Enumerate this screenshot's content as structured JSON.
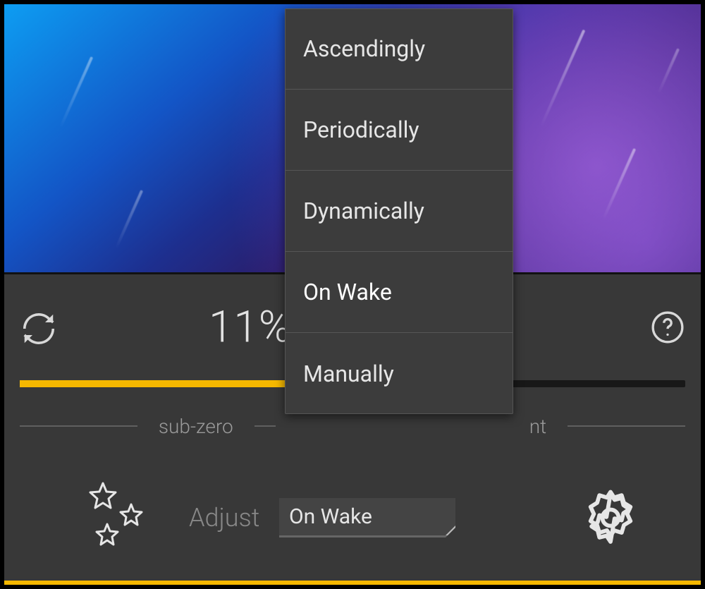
{
  "percent": "11%",
  "slider": {
    "labelLeft": "sub-zero",
    "labelRight": "nt"
  },
  "adjust": {
    "label": "Adjust",
    "selected": "On Wake"
  },
  "dropdown": {
    "items": [
      {
        "label": "Ascendingly"
      },
      {
        "label": "Periodically"
      },
      {
        "label": "Dynamically"
      },
      {
        "label": "On Wake"
      },
      {
        "label": "Manually"
      }
    ]
  },
  "colors": {
    "accent": "#f5b800"
  }
}
